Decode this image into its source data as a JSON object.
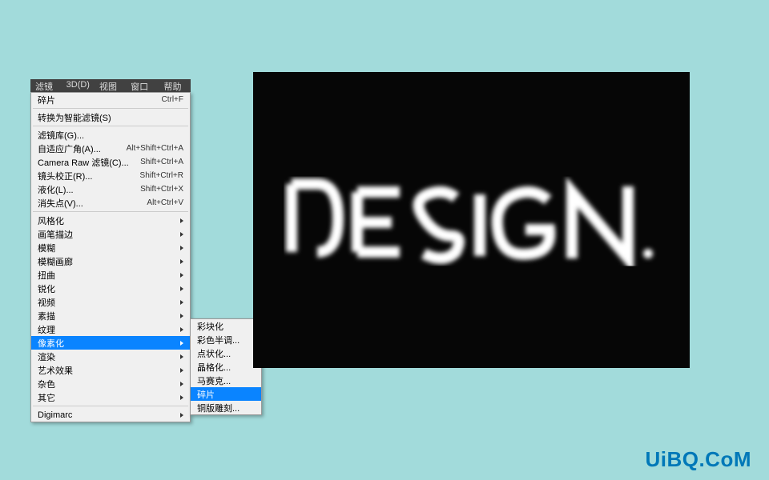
{
  "menubar": {
    "items": [
      {
        "label": "滤镜(T)"
      },
      {
        "label": "3D(D)"
      },
      {
        "label": "视图(V)"
      },
      {
        "label": "窗口(W)"
      },
      {
        "label": "帮助(H)"
      }
    ]
  },
  "dropdown": {
    "recent": {
      "label": "碎片",
      "shortcut": "Ctrl+F"
    },
    "convert": {
      "label": "转换为智能滤镜(S)"
    },
    "grp1": [
      {
        "label": "滤镜库(G)..."
      },
      {
        "label": "自适应广角(A)...",
        "shortcut": "Alt+Shift+Ctrl+A"
      },
      {
        "label": "Camera Raw 滤镜(C)...",
        "shortcut": "Shift+Ctrl+A"
      },
      {
        "label": "镜头校正(R)...",
        "shortcut": "Shift+Ctrl+R"
      },
      {
        "label": "液化(L)...",
        "shortcut": "Shift+Ctrl+X"
      },
      {
        "label": "消失点(V)...",
        "shortcut": "Alt+Ctrl+V"
      }
    ],
    "grp2": [
      {
        "label": "风格化"
      },
      {
        "label": "画笔描边"
      },
      {
        "label": "模糊"
      },
      {
        "label": "模糊画廊"
      },
      {
        "label": "扭曲"
      },
      {
        "label": "锐化"
      },
      {
        "label": "视频"
      },
      {
        "label": "素描"
      },
      {
        "label": "纹理"
      },
      {
        "label": "像素化",
        "selected": true
      },
      {
        "label": "渲染"
      },
      {
        "label": "艺术效果"
      },
      {
        "label": "杂色"
      },
      {
        "label": "其它"
      }
    ],
    "digimarc": {
      "label": "Digimarc"
    }
  },
  "submenu": {
    "items": [
      {
        "label": "彩块化"
      },
      {
        "label": "彩色半调..."
      },
      {
        "label": "点状化..."
      },
      {
        "label": "晶格化..."
      },
      {
        "label": "马赛克..."
      },
      {
        "label": "碎片",
        "selected": true
      },
      {
        "label": "铜版雕刻..."
      }
    ]
  },
  "canvas": {
    "text": "DESIGN"
  },
  "watermark": {
    "text": "UiBQ.CoM"
  }
}
